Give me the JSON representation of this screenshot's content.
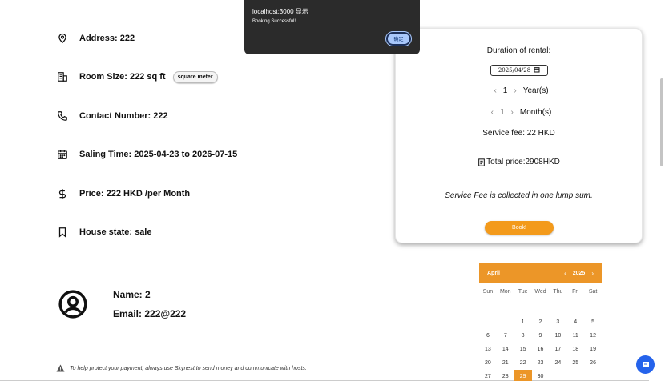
{
  "property": {
    "address": "Address: 222",
    "room_size": "Room Size: 222 sq ft",
    "unit_toggle": "square meter",
    "contact": "Contact Number: 222",
    "saling_time": "Saling Time: 2025-04-23 to 2026-07-15",
    "price": "Price: 222 HKD /per Month",
    "house_state": "House state: sale"
  },
  "host": {
    "name": "Name: 2",
    "email": "Email: 222@222"
  },
  "notice": "To help protect your payment, always use Skynest to send money and communicate with hosts.",
  "booking": {
    "duration_label": "Duration of rental:",
    "date_value": "2025/04/28",
    "years_value": "1",
    "years_unit": "Year(s)",
    "months_value": "1",
    "months_unit": "Month(s)",
    "service_fee": "Service fee: 22 HKD",
    "total_price": "Total price:2908HKD",
    "fee_note": "Service Fee is collected in one lump sum.",
    "book_label": "Book!"
  },
  "calendar": {
    "month": "April",
    "year": "2025",
    "weekdays": [
      "Sun",
      "Mon",
      "Tue",
      "Wed",
      "Thu",
      "Fri",
      "Sat"
    ],
    "selected_day": "29",
    "weeks": [
      [
        "",
        "",
        "",
        "",
        "",
        "",
        ""
      ],
      [
        "",
        "",
        "1",
        "2",
        "3",
        "4",
        "5"
      ],
      [
        "6",
        "7",
        "8",
        "9",
        "10",
        "11",
        "12"
      ],
      [
        "13",
        "14",
        "15",
        "16",
        "17",
        "18",
        "19"
      ],
      [
        "20",
        "21",
        "22",
        "23",
        "24",
        "25",
        "26"
      ],
      [
        "27",
        "28",
        "29",
        "30",
        "",
        "",
        ""
      ]
    ]
  },
  "dialog": {
    "title": "localhost:3000 显示",
    "message": "Booking Successful!",
    "ok_label": "确定"
  },
  "colors": {
    "accent": "#ec9628",
    "chat": "#2563eb"
  }
}
